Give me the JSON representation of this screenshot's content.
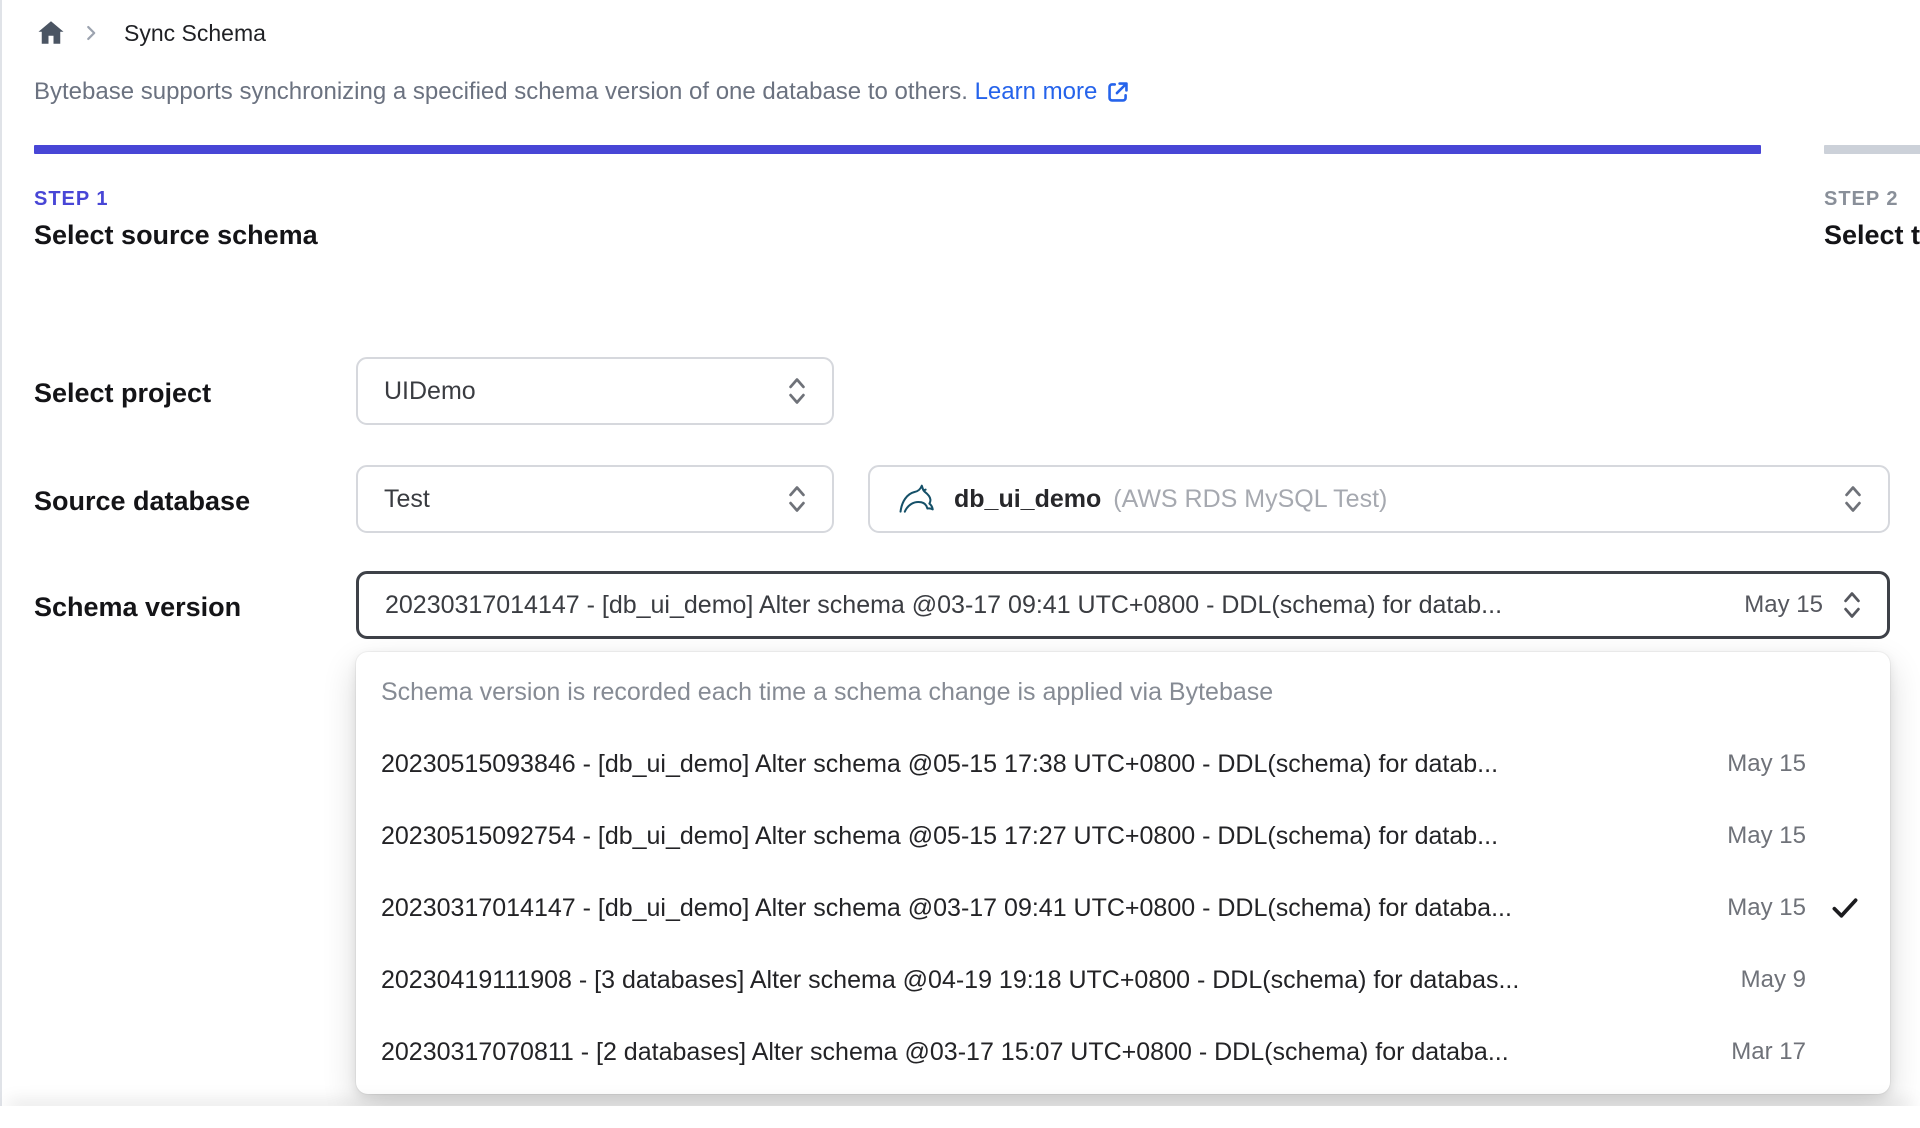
{
  "colors": {
    "accent_indigo": "#4846d6",
    "link_blue": "#2563eb",
    "inactive_gray": "#ccd1d9"
  },
  "breadcrumb": {
    "page_title": "Sync Schema"
  },
  "description": {
    "text": "Bytebase supports synchronizing a specified schema version of one database to others.",
    "link_label": "Learn more"
  },
  "steps": [
    {
      "label": "STEP 1",
      "title": "Select source schema"
    },
    {
      "label": "STEP 2",
      "title": "Select t"
    }
  ],
  "form": {
    "project": {
      "label": "Select project",
      "value": "UIDemo"
    },
    "source_database": {
      "label": "Source database",
      "environment_value": "Test",
      "database_value": "db_ui_demo",
      "database_detail": "(AWS RDS MySQL Test)"
    },
    "schema_version": {
      "label": "Schema version",
      "value": "20230317014147 - [db_ui_demo] Alter schema @03-17 09:41 UTC+0800 - DDL(schema) for datab...",
      "date": "May 15"
    }
  },
  "dropdown": {
    "header": "Schema version is recorded each time a schema change is applied via Bytebase",
    "options": [
      {
        "text": "20230515093846 - [db_ui_demo] Alter schema @05-15 17:38 UTC+0800 - DDL(schema) for datab...",
        "date": "May 15",
        "selected": false
      },
      {
        "text": "20230515092754 - [db_ui_demo] Alter schema @05-15 17:27 UTC+0800 - DDL(schema) for datab...",
        "date": "May 15",
        "selected": false
      },
      {
        "text": "20230317014147 - [db_ui_demo] Alter schema @03-17 09:41 UTC+0800 - DDL(schema) for databa...",
        "date": "May 15",
        "selected": true
      },
      {
        "text": "20230419111908 - [3 databases] Alter schema @04-19 19:18 UTC+0800 - DDL(schema) for databas...",
        "date": "May 9",
        "selected": false
      },
      {
        "text": "20230317070811 - [2 databases] Alter schema @03-17 15:07 UTC+0800 - DDL(schema) for databa...",
        "date": "Mar 17",
        "selected": false
      }
    ]
  }
}
